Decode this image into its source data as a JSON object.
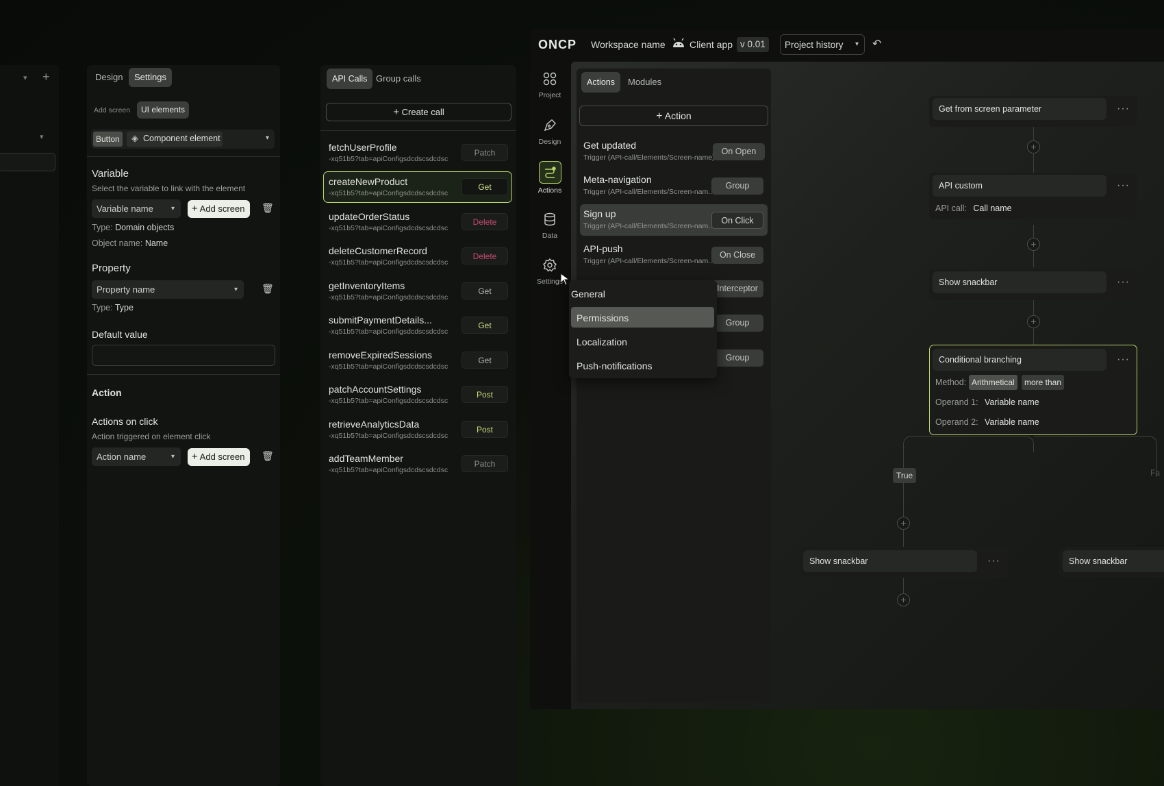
{
  "far_left": {
    "plus": "+"
  },
  "design_panel": {
    "tabs": [
      "Design",
      "Settings"
    ],
    "subtabs": [
      "Add screen",
      "UI elements"
    ],
    "element_tag": "Button",
    "element_name": "Component element",
    "variable": {
      "title": "Variable",
      "hint": "Select the variable to link with the element",
      "select": "Variable name",
      "add_button": "Add screen",
      "type_label": "Type:",
      "type_value": "Domain objects",
      "object_label": "Object name:",
      "object_value": "Name"
    },
    "property": {
      "title": "Property",
      "select": "Property name",
      "type_label": "Type:",
      "type_value": "Type"
    },
    "default_value": {
      "title": "Default value",
      "value": ""
    },
    "action": {
      "title": "Action",
      "on_click_title": "Actions on click",
      "on_click_hint": "Action triggered on element click",
      "select": "Action name",
      "add_button": "Add screen"
    }
  },
  "api_panel": {
    "tabs": [
      "API Calls",
      "Group calls"
    ],
    "create_button": "Create call",
    "calls": [
      {
        "name": "fetchUserProfile",
        "path": "-xq51b5?tab=apiConfigsdcdscsdcdsc",
        "method": "Patch"
      },
      {
        "name": "createNewProduct",
        "path": "-xq51b5?tab=apiConfigsdcdscsdcdsc",
        "method": "Get"
      },
      {
        "name": "updateOrderStatus",
        "path": "-xq51b5?tab=apiConfigsdcdscsdcdsc",
        "method": "Delete"
      },
      {
        "name": "deleteCustomerRecord",
        "path": "-xq51b5?tab=apiConfigsdcdscsdcdsc",
        "method": "Delete"
      },
      {
        "name": "getInventoryItems",
        "path": "-xq51b5?tab=apiConfigsdcdscsdcdsc",
        "method": "Get"
      },
      {
        "name": "submitPaymentDetails...",
        "path": "-xq51b5?tab=apiConfigsdcdscsdcdsc",
        "method": "Get"
      },
      {
        "name": "removeExpiredSessions",
        "path": "-xq51b5?tab=apiConfigsdcdscsdcdsc",
        "method": "Get"
      },
      {
        "name": "patchAccountSettings",
        "path": "-xq51b5?tab=apiConfigsdcdscsdcdsc",
        "method": "Post"
      },
      {
        "name": "retrieveAnalyticsData",
        "path": "-xq51b5?tab=apiConfigsdcdscsdcdsc",
        "method": "Post"
      },
      {
        "name": "addTeamMember",
        "path": "-xq51b5?tab=apiConfigsdcdscsdcdsc",
        "method": "Patch"
      }
    ]
  },
  "topbar": {
    "logo": "ONCP",
    "workspace": "Workspace name",
    "app": "Client app",
    "version": "v 0.01",
    "history": "Project history"
  },
  "rail": {
    "items": [
      {
        "label": "Project",
        "icon": "project-grid-icon"
      },
      {
        "label": "Design",
        "icon": "pen-tool-icon"
      },
      {
        "label": "Actions",
        "icon": "actions-flow-icon"
      },
      {
        "label": "Data",
        "icon": "database-icon"
      },
      {
        "label": "Settings",
        "icon": "gear-icon"
      }
    ]
  },
  "actions_panel": {
    "tabs": [
      "Actions",
      "Modules"
    ],
    "add_button": "Action",
    "items": [
      {
        "name": "Get updated",
        "trigger": "Trigger (API-call/Elements/Screen-name)",
        "badge": "On Open"
      },
      {
        "name": "Meta-navigation",
        "trigger": "Trigger (API-call/Elements/Screen-nam...",
        "badge": "Group"
      },
      {
        "name": "Sign up",
        "trigger": "Trigger (API-call/Elements/Screen-nam...",
        "badge": "On Click"
      },
      {
        "name": "API-push",
        "trigger": "Trigger (API-call/Elements/Screen-nam...",
        "badge": "On Close"
      }
    ],
    "hidden_badges": [
      "Interceptor",
      "Group",
      "Group"
    ]
  },
  "settings_menu": {
    "items": [
      "General",
      "Permissions",
      "Localization",
      "Push-notifications"
    ],
    "selected": "Permissions"
  },
  "flow": {
    "get_param": "Get from screen parameter",
    "api_custom": "API custom",
    "api_call_label": "API call:",
    "api_call_value": "Call name",
    "snackbar1": "Show snackbar",
    "branch": {
      "title": "Conditional branching",
      "method_label": "Method:",
      "method_value": "Arithmetical",
      "method_op": "more than",
      "op1_label": "Operand 1:",
      "op1_value": "Variable name",
      "op2_label": "Operand 2:",
      "op2_value": "Variable name"
    },
    "true_label": "True",
    "snackbar2": "Show snackbar",
    "snackbar3": "Show snackbar",
    "dots": "···",
    "false_label_partial": "Fa"
  },
  "colors": {
    "accent": "#b9d46c",
    "delete": "#c44a73",
    "get": "#cfe08a",
    "post": "#c9d778"
  }
}
